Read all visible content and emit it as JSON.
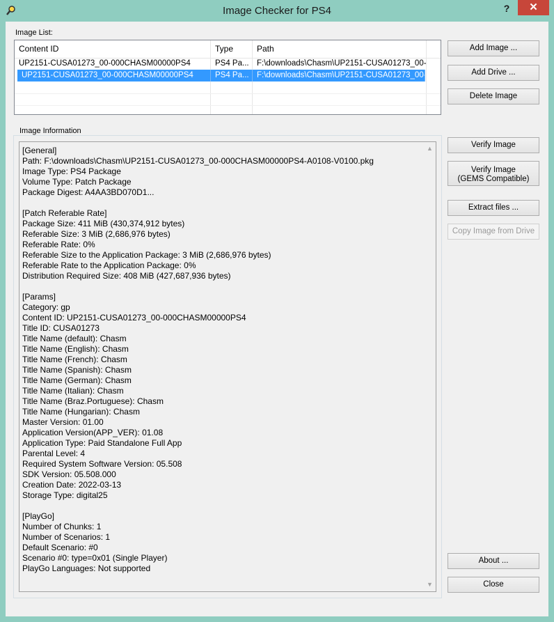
{
  "window": {
    "title": "Image Checker for PS4",
    "help_label": "?",
    "close_label": "✕"
  },
  "image_list": {
    "label": "Image List:",
    "columns": [
      "Content ID",
      "Type",
      "Path"
    ],
    "rows": [
      {
        "content_id": "UP2151-CUSA01273_00-000CHASM00000PS4",
        "type": "PS4 Pa...",
        "path": "F:\\downloads\\Chasm\\UP2151-CUSA01273_00-...",
        "selected": false
      },
      {
        "content_id": "UP2151-CUSA01273_00-000CHASM00000PS4",
        "type": "PS4 Pa...",
        "path": "F:\\downloads\\Chasm\\UP2151-CUSA01273_00-...",
        "selected": true
      }
    ]
  },
  "buttons": {
    "add_image": "Add Image ...",
    "add_drive": "Add Drive ...",
    "delete_image": "Delete Image",
    "verify_image": "Verify Image",
    "verify_gems_line1": "Verify Image",
    "verify_gems_line2": "(GEMS Compatible)",
    "extract_files": "Extract files ...",
    "copy_from_drive": "Copy Image from Drive",
    "about": "About ...",
    "close": "Close"
  },
  "image_information": {
    "label": "Image Information",
    "text": "[General]\nPath: F:\\downloads\\Chasm\\UP2151-CUSA01273_00-000CHASM00000PS4-A0108-V0100.pkg\nImage Type: PS4 Package\nVolume Type: Patch Package\nPackage Digest: A4AA3BD070D1...\n\n[Patch Referable Rate]\nPackage Size: 411 MiB (430,374,912 bytes)\nReferable Size: 3 MiB (2,686,976 bytes)\nReferable Rate: 0%\nReferable Size to the Application Package: 3 MiB (2,686,976 bytes)\nReferable Rate to the Application Package: 0%\nDistribution Required Size: 408 MiB (427,687,936 bytes)\n\n[Params]\nCategory: gp\nContent ID: UP2151-CUSA01273_00-000CHASM00000PS4\nTitle ID: CUSA01273\nTitle Name (default): Chasm\nTitle Name (English): Chasm\nTitle Name (French): Chasm\nTitle Name (Spanish): Chasm\nTitle Name (German): Chasm\nTitle Name (Italian): Chasm\nTitle Name (Braz.Portuguese): Chasm\nTitle Name (Hungarian): Chasm\nMaster Version: 01.00\nApplication Version(APP_VER): 01.08\nApplication Type: Paid Standalone Full App\nParental Level: 4\nRequired System Software Version: 05.508\nSDK Version: 05.508.000\nCreation Date: 2022-03-13\nStorage Type: digital25\n\n[PlayGo]\nNumber of Chunks: 1\nNumber of Scenarios: 1\nDefault Scenario: #0\nScenario #0: type=0x01 (Single Player)\nPlayGo Languages: Not supported"
  },
  "colors": {
    "frame": "#8fcdc0",
    "selection": "#3399ff",
    "close_button": "#c7463a"
  }
}
